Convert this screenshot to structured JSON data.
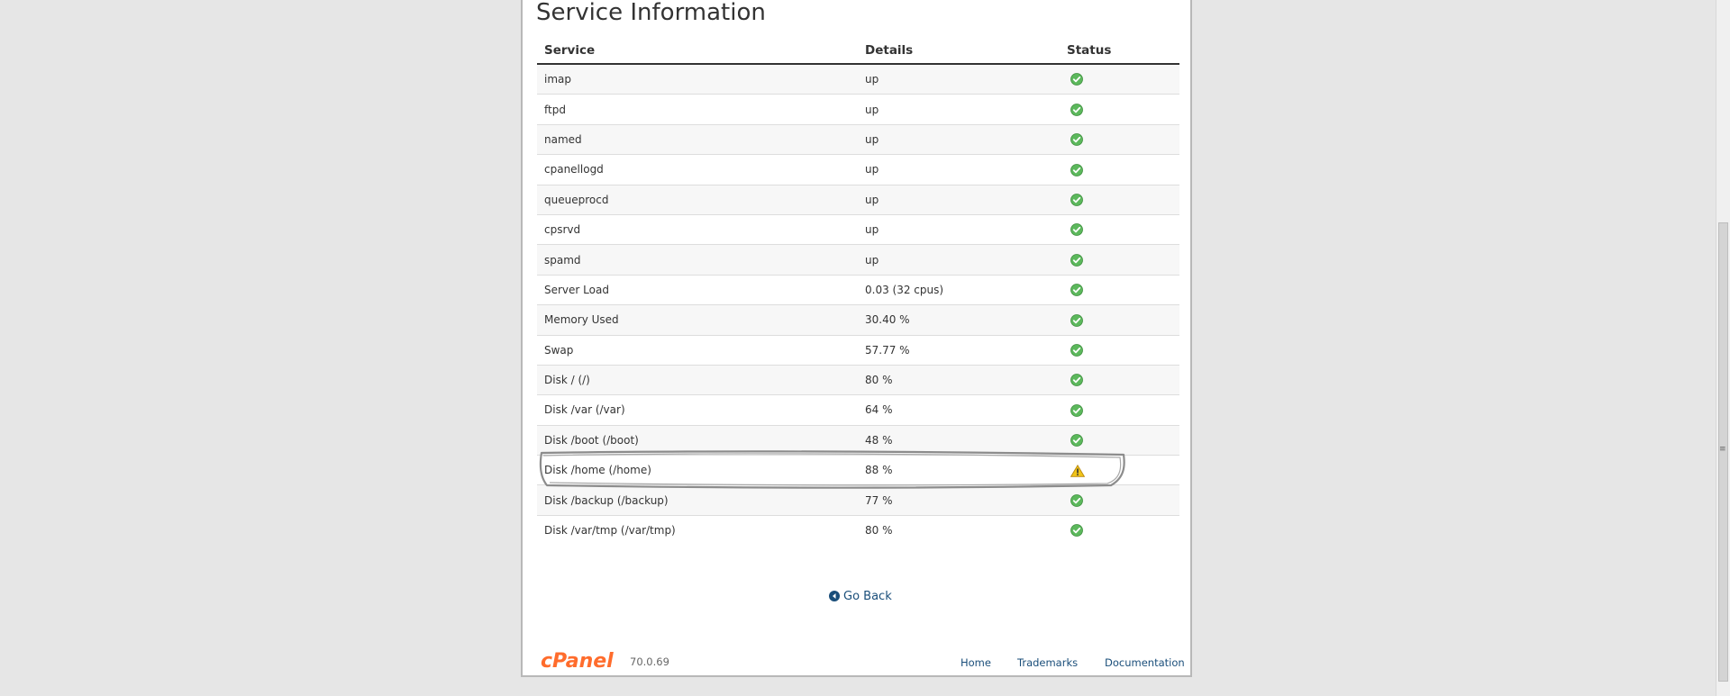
{
  "page": {
    "title": "Service Information",
    "columns": {
      "service": "Service",
      "details": "Details",
      "status": "Status"
    },
    "services": [
      {
        "name": "imap",
        "details": "up",
        "status": "ok"
      },
      {
        "name": "ftpd",
        "details": "up",
        "status": "ok"
      },
      {
        "name": "named",
        "details": "up",
        "status": "ok"
      },
      {
        "name": "cpanellogd",
        "details": "up",
        "status": "ok"
      },
      {
        "name": "queueprocd",
        "details": "up",
        "status": "ok"
      },
      {
        "name": "cpsrvd",
        "details": "up",
        "status": "ok"
      },
      {
        "name": "spamd",
        "details": "up",
        "status": "ok"
      },
      {
        "name": "Server Load",
        "details": "0.03 (32 cpus)",
        "status": "ok"
      },
      {
        "name": "Memory Used",
        "details": "30.40 %",
        "status": "ok"
      },
      {
        "name": "Swap",
        "details": "57.77 %",
        "status": "ok"
      },
      {
        "name": "Disk / (/)",
        "details": "80 %",
        "status": "ok"
      },
      {
        "name": "Disk /var (/var)",
        "details": "64 %",
        "status": "ok"
      },
      {
        "name": "Disk /boot (/boot)",
        "details": "48 %",
        "status": "ok"
      },
      {
        "name": "Disk /home (/home)",
        "details": "88 %",
        "status": "warning"
      },
      {
        "name": "Disk /backup (/backup)",
        "details": "77 %",
        "status": "ok"
      },
      {
        "name": "Disk /var/tmp (/var/tmp)",
        "details": "80 %",
        "status": "ok"
      }
    ],
    "go_back": "Go Back"
  },
  "footer": {
    "logo_text": "cPanel",
    "version": "70.0.69",
    "links": [
      "Home",
      "Trademarks",
      "Documentation"
    ]
  },
  "colors": {
    "ok": "#5cb85c",
    "warning": "#f0c419",
    "link": "#1a4e7a",
    "brand": "#ff6c2c"
  },
  "icons": {
    "ok": "check-circle-icon",
    "warning": "warning-triangle-icon",
    "go_back": "arrow-circle-left-icon"
  }
}
